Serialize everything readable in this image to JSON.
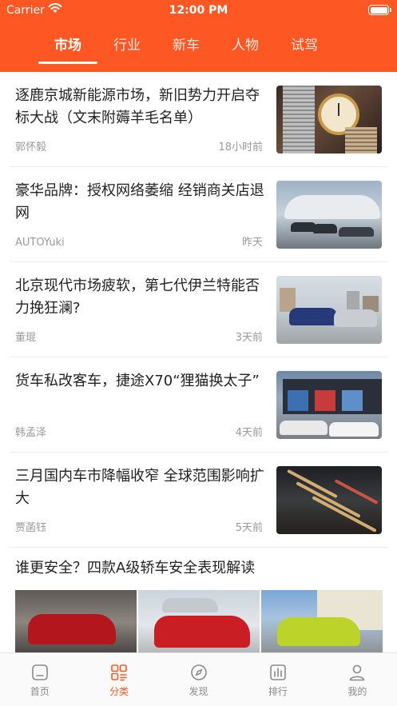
{
  "status_bar": {
    "carrier": "Carrier",
    "time": "12:00 PM"
  },
  "tabs": [
    {
      "label": "市场",
      "active": true
    },
    {
      "label": "行业",
      "active": false
    },
    {
      "label": "新车",
      "active": false
    },
    {
      "label": "人物",
      "active": false
    },
    {
      "label": "试驾",
      "active": false
    }
  ],
  "articles": [
    {
      "title": "逐鹿京城新能源市场，新旧势力开启夺标大战（文末附薅羊毛名单）",
      "author": "郭怀毅",
      "time": "18小时前",
      "thumb": "coins-clock-image"
    },
    {
      "title": "豪华品牌：授权网络萎缩 经销商关店退网",
      "author": "AUTOYuki",
      "time": "昨天",
      "thumb": "showroom-cars-image"
    },
    {
      "title": "北京现代市场疲软，第七代伊兰特能否力挽狂澜?",
      "author": "董琨",
      "time": "3天前",
      "thumb": "hyundai-sedans-image"
    },
    {
      "title": "货车私改客车，捷途X70“狸猫换太子”",
      "author": "韩孟泽",
      "time": "4天前",
      "thumb": "dealer-storefront-image"
    },
    {
      "title": "三月国内车市降幅收窄 全球范围影响扩大",
      "author": "贾菡钰",
      "time": "5天前",
      "thumb": "traffic-night-image"
    }
  ],
  "feature": {
    "title": "谁更安全？四款A级轿车安全表现解读",
    "images": [
      "red-sedan-image",
      "red-sedan-front-image",
      "green-civic-image"
    ]
  },
  "bottom_nav": [
    {
      "label": "首页",
      "icon": "home-icon",
      "active": false
    },
    {
      "label": "分类",
      "icon": "category-grid-icon",
      "active": true
    },
    {
      "label": "发现",
      "icon": "compass-icon",
      "active": false
    },
    {
      "label": "排行",
      "icon": "ranking-chart-icon",
      "active": false
    },
    {
      "label": "我的",
      "icon": "profile-icon",
      "active": false
    }
  ],
  "colors": {
    "accent": "#fd5723",
    "text": "#222222",
    "muted": "#999999"
  }
}
